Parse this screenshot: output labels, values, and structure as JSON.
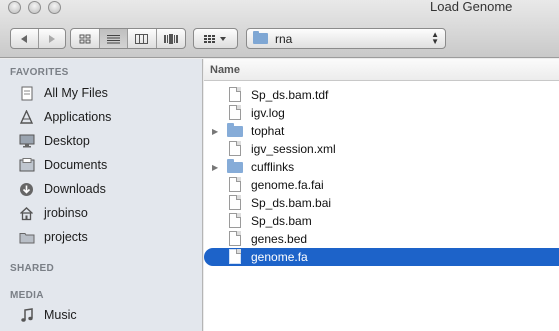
{
  "window": {
    "title": "Load Genome"
  },
  "toolbar": {
    "back_icon": "back-arrow-icon",
    "forward_icon": "forward-arrow-icon",
    "views": [
      "icon-view",
      "list-view",
      "column-view",
      "coverflow-view"
    ],
    "arrange_icon": "arrange-grid-icon",
    "path": {
      "current_folder": "rna"
    }
  },
  "sidebar": {
    "sections": [
      {
        "label": "FAVORITES"
      },
      {
        "label": "SHARED"
      },
      {
        "label": "MEDIA"
      }
    ],
    "favorites": [
      {
        "label": "All My Files",
        "icon": "all-files-icon"
      },
      {
        "label": "Applications",
        "icon": "applications-icon"
      },
      {
        "label": "Desktop",
        "icon": "desktop-icon"
      },
      {
        "label": "Documents",
        "icon": "documents-icon"
      },
      {
        "label": "Downloads",
        "icon": "downloads-icon"
      },
      {
        "label": "jrobinso",
        "icon": "home-icon"
      },
      {
        "label": "projects",
        "icon": "folder-icon"
      }
    ],
    "media": [
      {
        "label": "Music",
        "icon": "music-icon"
      }
    ]
  },
  "list": {
    "column_header": "Name",
    "rows": [
      {
        "name": "Sp_ds.bam.tdf",
        "kind": "file"
      },
      {
        "name": "igv.log",
        "kind": "file"
      },
      {
        "name": "tophat",
        "kind": "folder"
      },
      {
        "name": "igv_session.xml",
        "kind": "file"
      },
      {
        "name": "cufflinks",
        "kind": "folder"
      },
      {
        "name": "genome.fa.fai",
        "kind": "file"
      },
      {
        "name": "Sp_ds.bam.bai",
        "kind": "file"
      },
      {
        "name": "Sp_ds.bam",
        "kind": "file"
      },
      {
        "name": "genes.bed",
        "kind": "file"
      },
      {
        "name": "genome.fa",
        "kind": "file",
        "selected": true
      }
    ]
  },
  "colors": {
    "selection": "#1d63c9",
    "sidebar_bg": "#e3e7ed"
  }
}
